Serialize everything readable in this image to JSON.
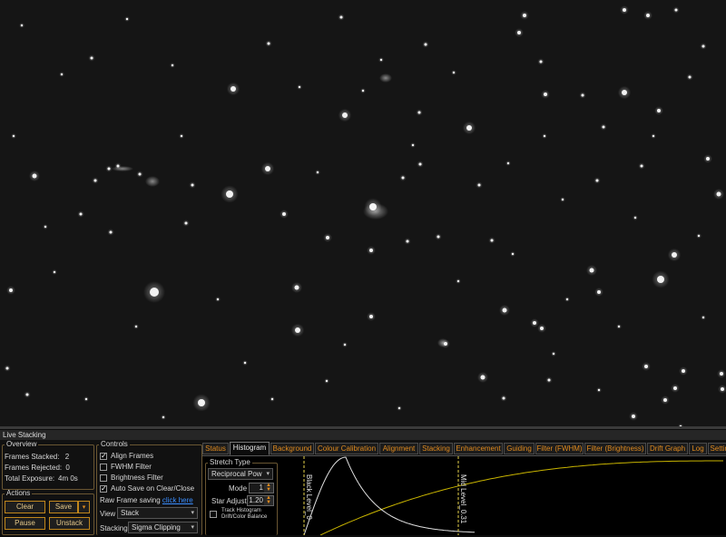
{
  "window_title": "Live Stacking",
  "overview": {
    "legend": "Overview",
    "frames_stacked_label": "Frames Stacked:",
    "frames_stacked": "2",
    "frames_rejected_label": "Frames Rejected:",
    "frames_rejected": "0",
    "total_exposure_label": "Total Exposure:",
    "total_exposure": "4m 0s"
  },
  "actions": {
    "legend": "Actions",
    "clear": "Clear",
    "save": "Save",
    "pause": "Pause",
    "unstack": "Unstack"
  },
  "controls": {
    "legend": "Controls",
    "align_frames": "Align Frames",
    "align_frames_checked": true,
    "fwhm_filter": "FWHM Filter",
    "fwhm_filter_checked": false,
    "brightness_filter": "Brightness Filter",
    "brightness_filter_checked": false,
    "auto_save": "Auto Save on Clear/Close",
    "auto_save_checked": true,
    "raw_frame_saving": "Raw Frame saving",
    "click_here": "click here",
    "view_label": "View",
    "view_value": "Stack",
    "stacking_label": "Stacking",
    "stacking_value": "Sigma Clipping"
  },
  "tabs": [
    "Status",
    "Histogram",
    "Background",
    "Colour Calibration",
    "Alignment",
    "Stacking",
    "Enhancement",
    "Guiding",
    "Filter (FWHM)",
    "Filter (Brightness)",
    "Drift Graph",
    "Log",
    "Settings"
  ],
  "active_tab": "Histogram",
  "stretch": {
    "legend": "Stretch Type",
    "type_value": "Reciprocal Pow",
    "mode_label": "Mode",
    "mode_value": "1",
    "star_adjust_label": "Star Adjust",
    "star_adjust_value": "1.20",
    "track_histogram": "Track Histogram Drift/Color Balance",
    "track_histogram_checked": false
  },
  "histogram": {
    "black_level_label": "Black Level_0",
    "mid_level_label": "Mid Level_0.31",
    "colors": {
      "curve": "#e0e0e0",
      "stretch": "#c8b400",
      "marker": "#e6d24a"
    }
  },
  "colors": {
    "accent": "#c0861c",
    "tab_text": "#e08a1e",
    "link": "#3a8eff"
  }
}
